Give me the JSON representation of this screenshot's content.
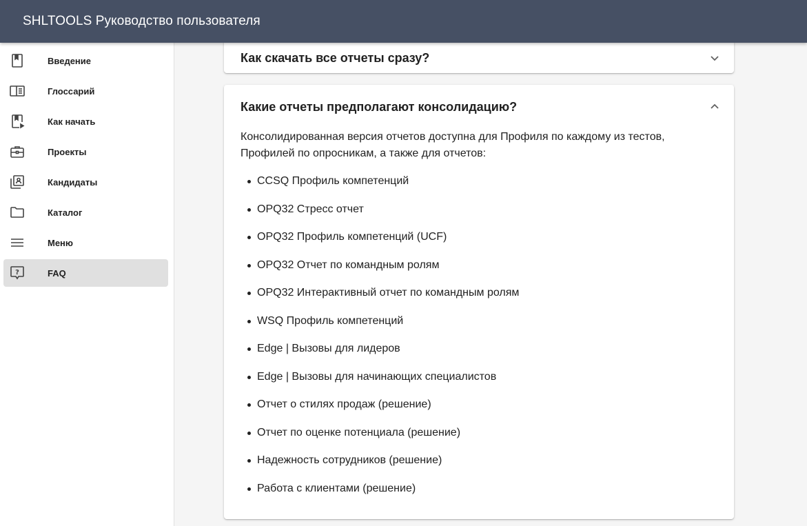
{
  "app": {
    "title": "SHLTOOLS Руководство пользователя"
  },
  "sidebar": {
    "items": [
      {
        "label": "Введение",
        "icon": "book-icon"
      },
      {
        "label": "Глоссарий",
        "icon": "glossary-icon"
      },
      {
        "label": "Как начать",
        "icon": "book-play-icon"
      },
      {
        "label": "Проекты",
        "icon": "briefcase-icon"
      },
      {
        "label": "Кандидаты",
        "icon": "contacts-icon"
      },
      {
        "label": "Каталог",
        "icon": "folder-icon"
      },
      {
        "label": "Меню",
        "icon": "menu-icon"
      },
      {
        "label": "FAQ",
        "icon": "faq-icon",
        "active": true
      }
    ]
  },
  "faq": {
    "collapsed_question": "Как скачать все отчеты сразу?",
    "expanded_question": "Какие отчеты предполагают консолидацию?",
    "answer_intro": "Консолидированная версия отчетов доступна для Профиля по каждому из тестов, Профилей по опросникам, а также для отчетов:",
    "reports": [
      "CCSQ Профиль компетенций",
      "OPQ32 Стресс отчет",
      "OPQ32 Профиль компетенций (UCF)",
      "OPQ32 Отчет по командным ролям",
      "OPQ32 Интерактивный отчет по командным ролям",
      "WSQ Профиль компетенций",
      "Edge | Вызовы для лидеров",
      "Edge | Вызовы для начинающих специалистов",
      "Отчет о стилях продаж (решение)",
      "Отчет по оценке потенциала (решение)",
      "Надежность сотрудников (решение)",
      "Работа с клиентами (решение)"
    ]
  },
  "colors": {
    "topbar": "#465064",
    "active_item": "#e0e0e0",
    "icon": "#424242"
  }
}
